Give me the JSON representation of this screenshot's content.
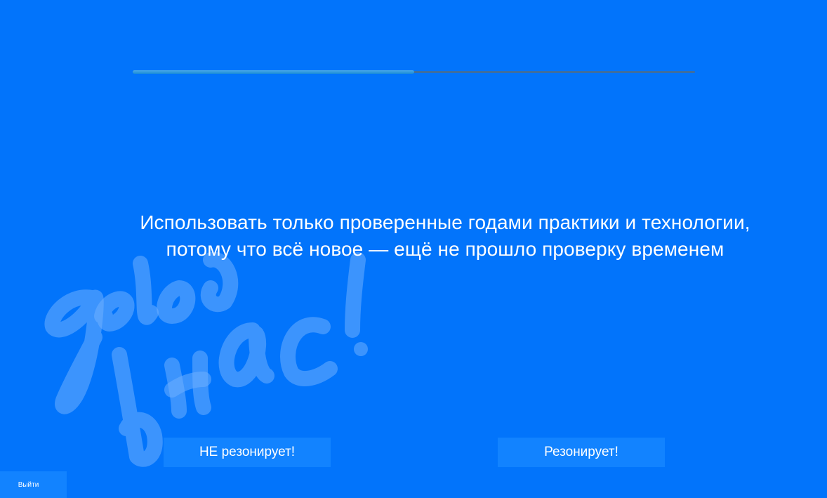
{
  "progress": {
    "fraction": 0.5
  },
  "statement": {
    "line1": "Использовать только проверенные годами практики и технологии,",
    "line2": "потому что всё новое — ещё не прошло проверку временем"
  },
  "buttons": {
    "not_resonates": "НЕ резонирует!",
    "resonates": "Резонирует!",
    "exit": "Выйти"
  },
  "watermark": {
    "text": "дело в нас!"
  },
  "colors": {
    "background": "#0274fb",
    "button": "#1283ff",
    "progress_fill": "#1b8fd6",
    "progress_track": "#3f6e9f"
  }
}
